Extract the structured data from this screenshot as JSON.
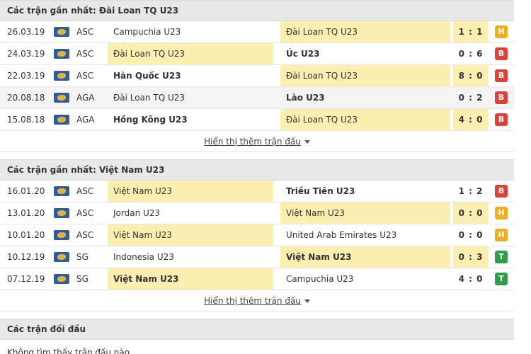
{
  "section1": {
    "title": "Các trận gần nhất: Đài Loan TQ U23",
    "rows": [
      {
        "date": "26.03.19",
        "league": "ASC",
        "home": "Campuchia U23",
        "away": "Đài Loan TQ U23",
        "score": "1 : 1",
        "result": "H"
      },
      {
        "date": "24.03.19",
        "league": "ASC",
        "home": "Đài Loan TQ U23",
        "away": "Úc U23",
        "score": "0 : 6",
        "result": "B"
      },
      {
        "date": "22.03.19",
        "league": "ASC",
        "home": "Hàn Quốc U23",
        "away": "Đài Loan TQ U23",
        "score": "8 : 0",
        "result": "B"
      },
      {
        "date": "20.08.18",
        "league": "AGA",
        "home": "Đài Loan TQ U23",
        "away": "Lào U23",
        "score": "0 : 2",
        "result": "B"
      },
      {
        "date": "15.08.18",
        "league": "AGA",
        "home": "Hồng Kông U23",
        "away": "Đài Loan TQ U23",
        "score": "4 : 0",
        "result": "B"
      }
    ],
    "more": "Hiển thị thêm trận đấu"
  },
  "section2": {
    "title": "Các trận gần nhất: Việt Nam U23",
    "rows": [
      {
        "date": "16.01.20",
        "league": "ASC",
        "home": "Việt Nam U23",
        "away": "Triều Tiên U23",
        "score": "1 : 2",
        "result": "B"
      },
      {
        "date": "13.01.20",
        "league": "ASC",
        "home": "Jordan U23",
        "away": "Việt Nam U23",
        "score": "0 : 0",
        "result": "H"
      },
      {
        "date": "10.01.20",
        "league": "ASC",
        "home": "Việt Nam U23",
        "away": "United Arab Emirates U23",
        "score": "0 : 0",
        "result": "H"
      },
      {
        "date": "10.12.19",
        "league": "SG",
        "home": "Indonesia U23",
        "away": "Việt Nam U23",
        "score": "0 : 3",
        "result": "T"
      },
      {
        "date": "07.12.19",
        "league": "SG",
        "home": "Việt Nam U23",
        "away": "Campuchia U23",
        "score": "4 : 0",
        "result": "T"
      }
    ],
    "more": "Hiển thị thêm trận đấu"
  },
  "section3": {
    "title": "Các trận đối đầu",
    "empty": "Không tìm thấy trận đấu nào."
  },
  "colors": {
    "highlight": "#fbeeb1",
    "draw": "#f0ad22",
    "loss": "#d9443a",
    "win": "#2e9e48"
  },
  "icons": {
    "league_flag": "world-map-flag-icon",
    "more_caret": "caret-down-icon"
  }
}
